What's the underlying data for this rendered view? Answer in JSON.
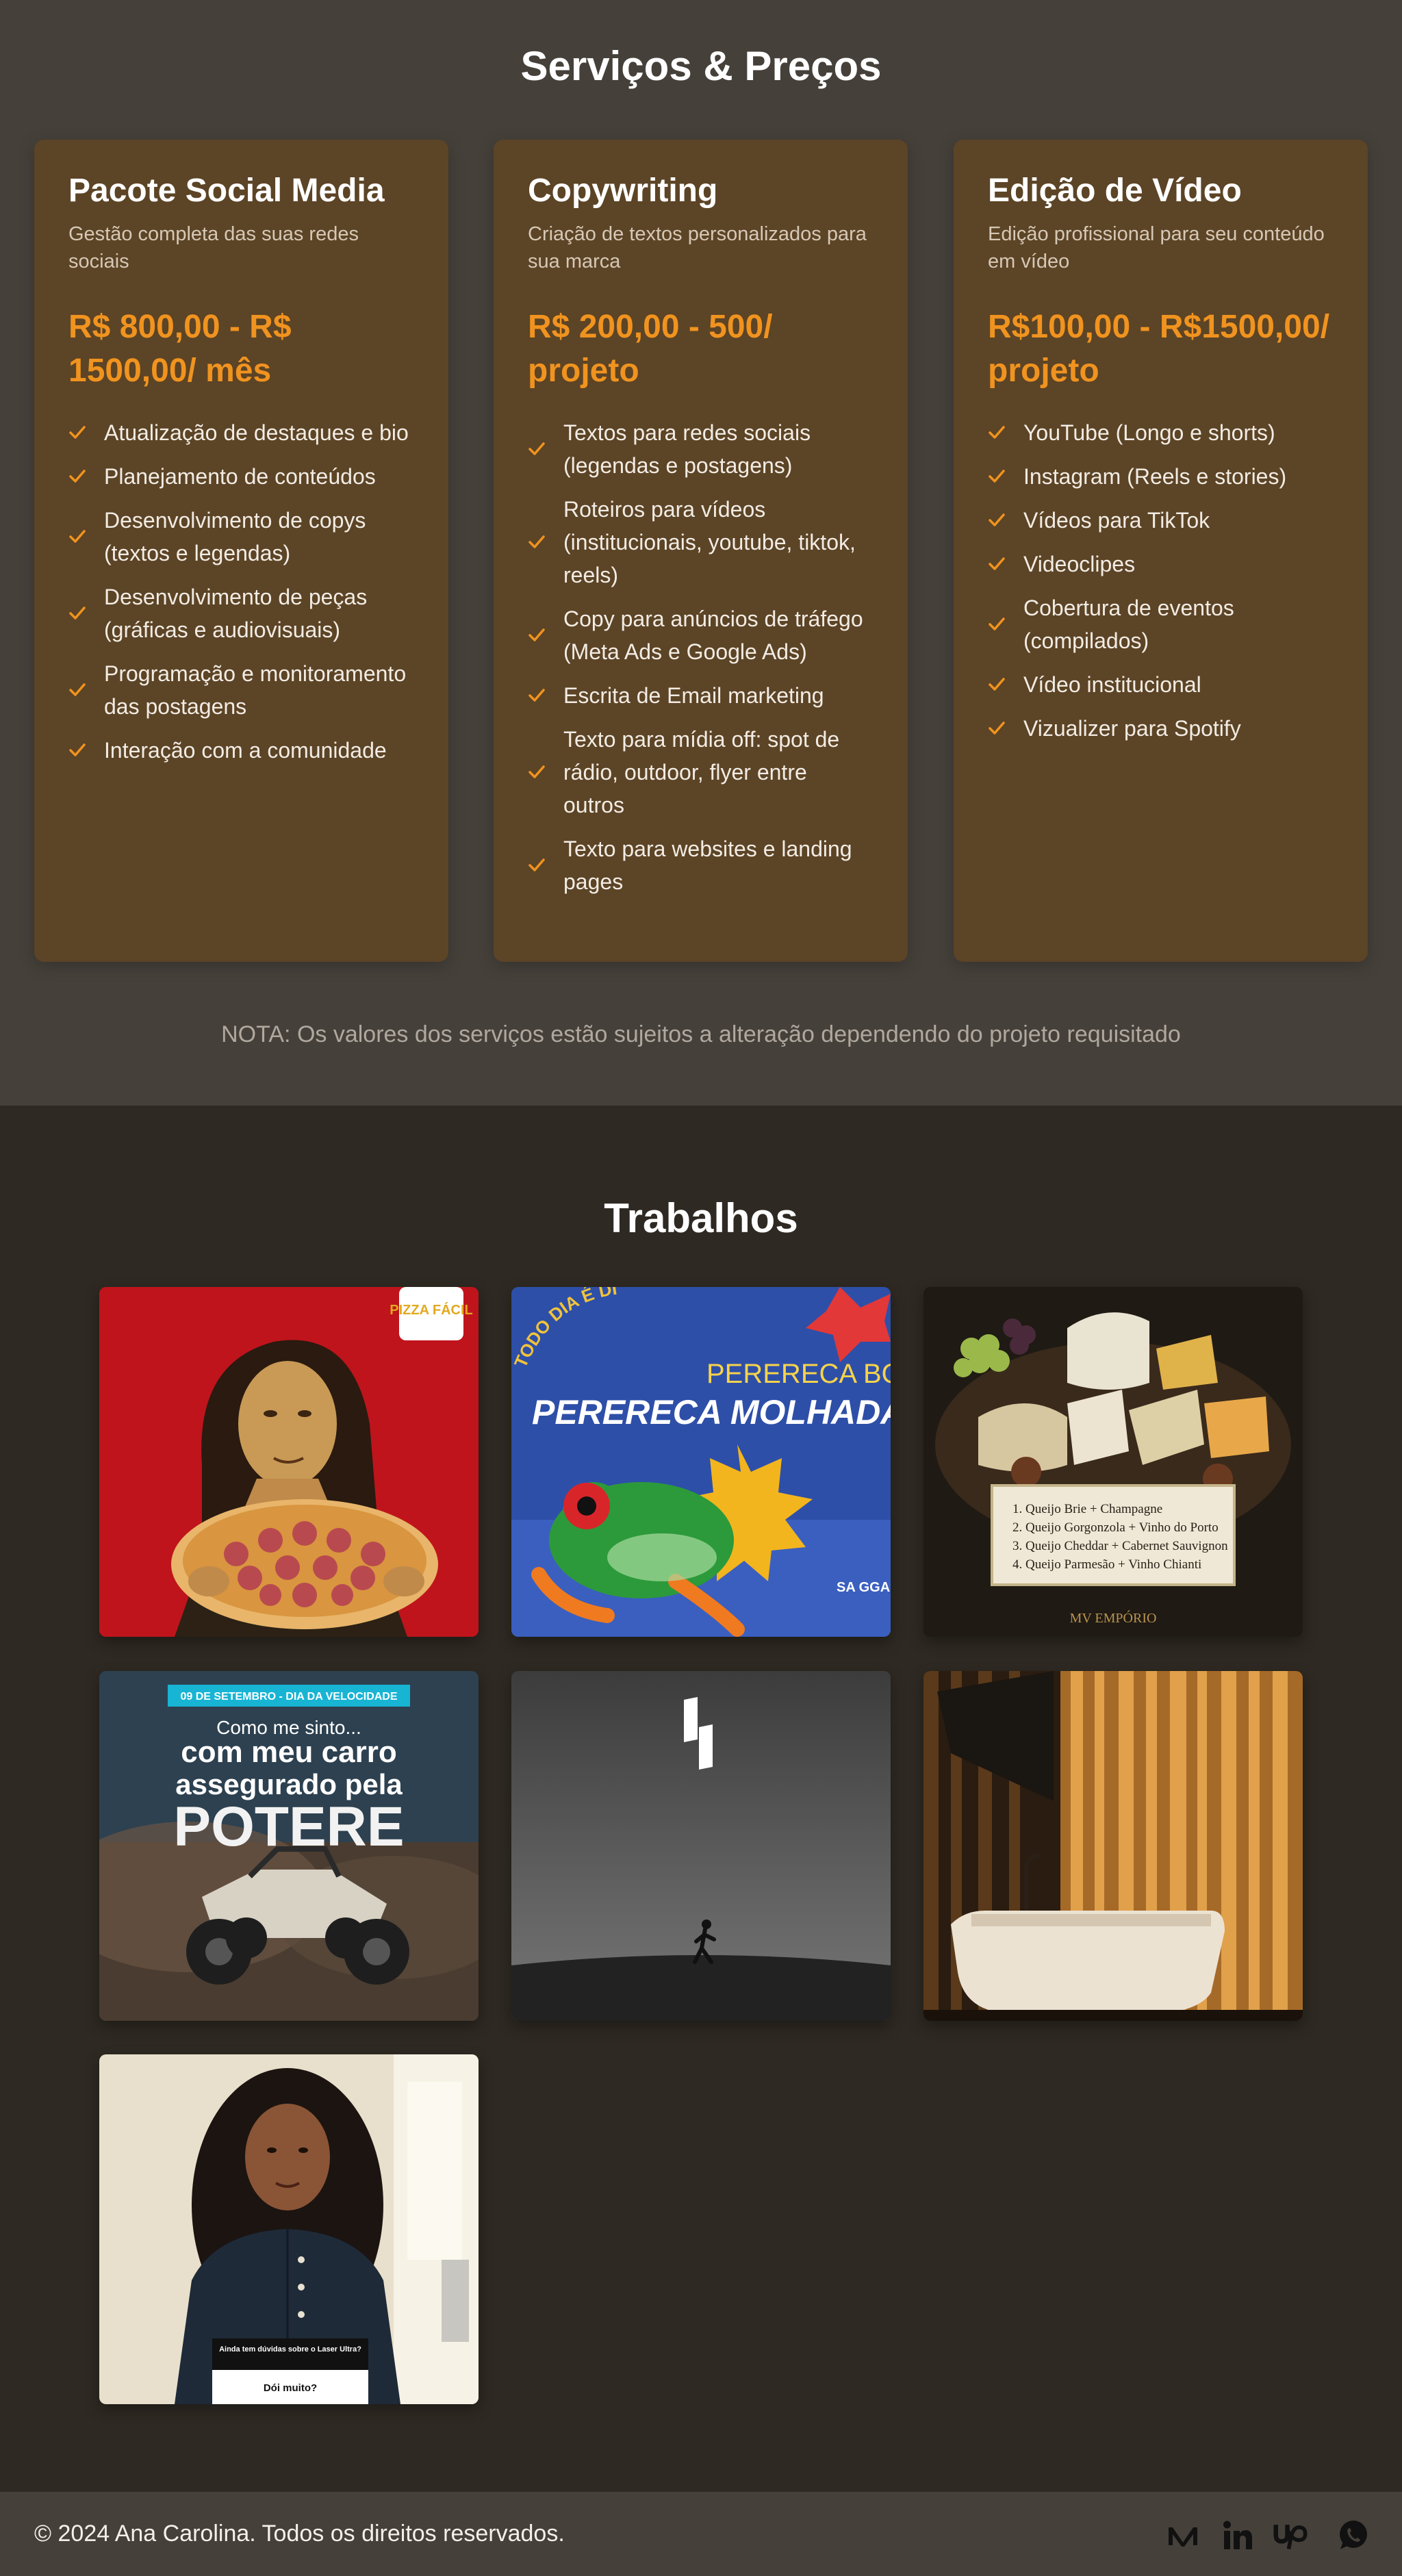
{
  "services": {
    "title": "Serviços & Preços",
    "cards": [
      {
        "title": "Pacote Social Media",
        "subtitle": "Gestão completa das suas redes sociais",
        "price": "R$ 800,00 - R$ 1500,00/ mês",
        "features": [
          "Atualização de destaques e bio",
          "Planejamento de conteúdos",
          "Desenvolvimento de copys (textos e legendas)",
          "Desenvolvimento de peças (gráficas e audiovisuais)",
          "Programação e monitoramento das postagens",
          "Interação com a comunidade"
        ]
      },
      {
        "title": "Copywriting",
        "subtitle": "Criação de textos personalizados para sua marca",
        "price": "R$ 200,00 - 500/ projeto",
        "features": [
          "Textos para redes sociais (legendas e postagens)",
          "Roteiros para vídeos (institucionais, youtube, tiktok, reels)",
          "Copy para anúncios de tráfego (Meta Ads e Google Ads)",
          "Escrita de Email marketing",
          "Texto para mídia off: spot de rádio, outdoor, flyer entre outros",
          "Texto para websites e landing pages"
        ]
      },
      {
        "title": "Edição de Vídeo",
        "subtitle": "Edição profissional para seu conteúdo em vídeo",
        "price": "R$100,00 - R$1500,00/ projeto",
        "features": [
          "YouTube (Longo e shorts)",
          "Instagram (Reels e stories)",
          "Vídeos para TikTok",
          "Videoclipes",
          "Cobertura de eventos (compilados)",
          "Vídeo institucional",
          "Vizualizer para Spotify"
        ]
      }
    ],
    "note": "NOTA: Os valores dos serviços estão sujeitos a alteração dependendo do projeto requisitado"
  },
  "works": {
    "title": "Trabalhos",
    "pizza": {
      "badge": "PIZZA FÁCIL"
    },
    "frog": {
      "arc": "TODO DIA É DIA DE FEIRA!",
      "line1": "PERERECA BOA É",
      "line2": "PERERECA MOLHADA!",
      "brand": "SA GGA RI BAE"
    },
    "cheese": {
      "items": [
        "1. Queijo Brie + Champagne",
        "2. Queijo Gorgonzola + Vinho do Porto",
        "3. Queijo Cheddar + Cabernet Sauvignon",
        "4. Queijo Parmesão + Vinho Chianti"
      ],
      "brand": "MV EMPÓRIO"
    },
    "car": {
      "banner": "09 DE SETEMBRO - DIA DA VELOCIDADE",
      "line1": "Como me sinto...",
      "line2": "com meu carro",
      "line3": "assegurado pela",
      "line4": "POTERE"
    },
    "portrait": {
      "question": "Ainda tem dúvidas sobre o Laser Ultra?",
      "answer": "Dói muito?"
    }
  },
  "footer": {
    "copyright": "© 2024 Ana Carolina. Todos os direitos reservados."
  },
  "colors": {
    "accent": "#f0931f",
    "card": "#5c4426",
    "services_bg": "#45403a",
    "works_bg": "#2e2922"
  },
  "icons": [
    "check-icon",
    "medium-icon",
    "linkedin-icon",
    "upwork-icon",
    "whatsapp-icon"
  ]
}
